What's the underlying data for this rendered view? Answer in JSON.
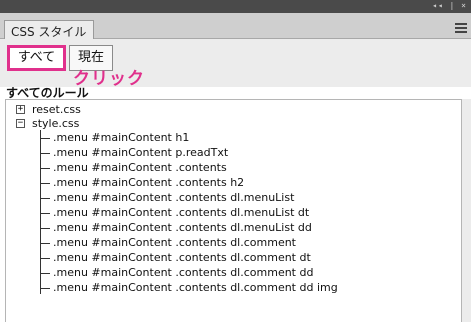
{
  "window": {
    "controls": "◂◂ | ×"
  },
  "panel": {
    "tab_label": "CSS スタイル"
  },
  "toolbar": {
    "all_label": "すべて",
    "current_label": "現在"
  },
  "annotation": {
    "text": "クリック",
    "color": "#e0308c"
  },
  "section": {
    "title": "すべてのルール"
  },
  "tree": {
    "files": [
      {
        "name": "reset.css",
        "expanded": false,
        "toggle": "+"
      },
      {
        "name": "style.css",
        "expanded": true,
        "toggle": "−"
      }
    ],
    "rules": [
      ".menu #mainContent h1",
      ".menu #mainContent p.readTxt",
      ".menu #mainContent .contents",
      ".menu #mainContent .contents h2",
      ".menu #mainContent .contents dl.menuList",
      ".menu #mainContent .contents dl.menuList dt",
      ".menu #mainContent .contents dl.menuList dd",
      ".menu #mainContent .contents dl.comment",
      ".menu #mainContent .contents dl.comment dt",
      ".menu #mainContent .contents dl.comment dd",
      ".menu #mainContent .contents dl.comment dd img"
    ]
  }
}
